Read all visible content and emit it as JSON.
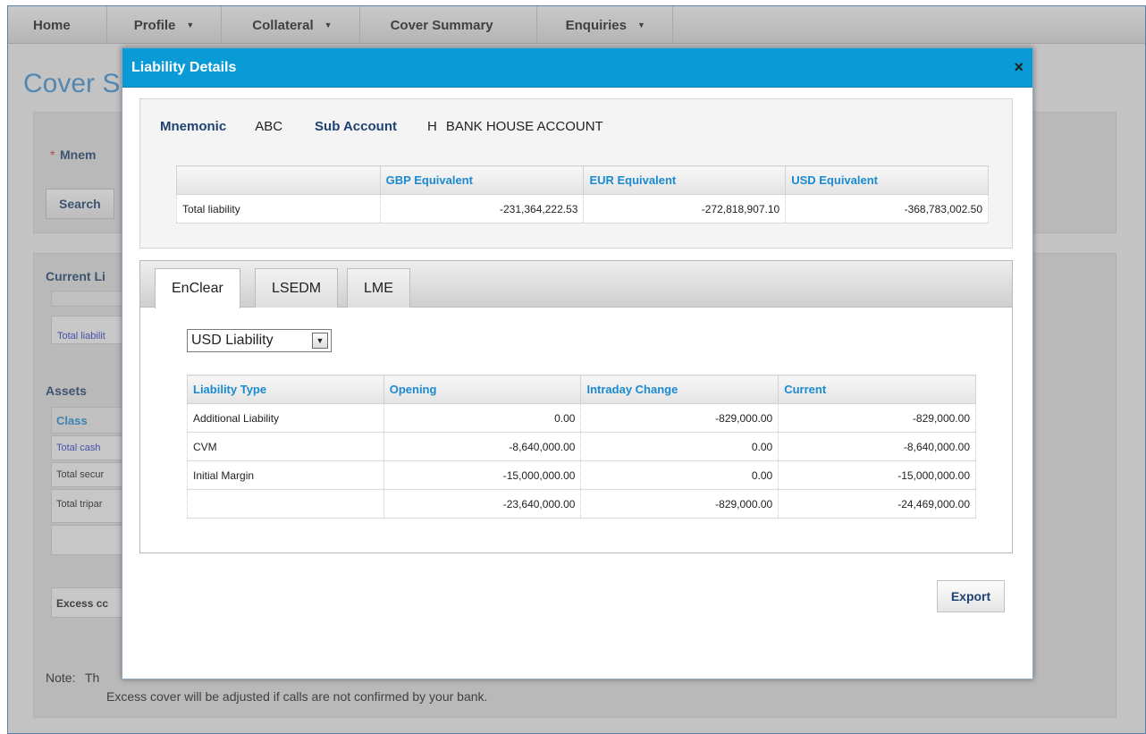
{
  "nav": {
    "items": [
      {
        "label": "Home",
        "caret": false
      },
      {
        "label": "Profile",
        "caret": true
      },
      {
        "label": "Collateral",
        "caret": true
      },
      {
        "label": "Cover Summary",
        "caret": false
      },
      {
        "label": "Enquiries",
        "caret": true
      }
    ]
  },
  "background": {
    "page_title": "Cover S",
    "mnemonic_label": "Mnem",
    "required_star": "*",
    "search_button": "Search",
    "current_liability": "Current Li",
    "total_liability": "Total liabilit",
    "assets": "Assets",
    "class_header": "Class",
    "rows": [
      "Total cash",
      "Total secur",
      "Total tripar"
    ],
    "excess": "Excess cc",
    "note_label": "Note:",
    "note_line1": "Th",
    "note_line2": "Excess cover will be adjusted if calls are not confirmed by your bank."
  },
  "modal": {
    "title": "Liability Details",
    "close_icon": "×",
    "mnemonic_label": "Mnemonic",
    "mnemonic_value": "ABC",
    "sub_account_label": "Sub Account",
    "sub_account_code": "H",
    "sub_account_name": "BANK HOUSE ACCOUNT",
    "summary_table": {
      "headers": [
        "",
        "GBP Equivalent",
        "EUR Equivalent",
        "USD Equivalent"
      ],
      "row": {
        "label": "Total liability",
        "gbp": "-231,364,222.53",
        "eur": "-272,818,907.10",
        "usd": "-368,783,002.50"
      }
    },
    "tabs": [
      {
        "label": "EnClear",
        "active": true
      },
      {
        "label": "LSEDM",
        "active": false
      },
      {
        "label": "LME",
        "active": false
      }
    ],
    "currency_select": {
      "selected": "USD Liability"
    },
    "liability_table": {
      "headers": [
        "Liability Type",
        "Opening",
        "Intraday Change",
        "Current"
      ],
      "rows": [
        {
          "type": "Additional Liability",
          "opening": "0.00",
          "intraday": "-829,000.00",
          "current": "-829,000.00"
        },
        {
          "type": "CVM",
          "opening": "-8,640,000.00",
          "intraday": "0.00",
          "current": "-8,640,000.00"
        },
        {
          "type": "Initial Margin",
          "opening": "-15,000,000.00",
          "intraday": "0.00",
          "current": "-15,000,000.00"
        },
        {
          "type": "",
          "opening": "-23,640,000.00",
          "intraday": "-829,000.00",
          "current": "-24,469,000.00"
        }
      ]
    },
    "export_button": "Export"
  },
  "colors": {
    "header_blue": "#0a9ad6",
    "label_navy": "#1f4271",
    "column_header_blue": "#1b8ad0"
  }
}
